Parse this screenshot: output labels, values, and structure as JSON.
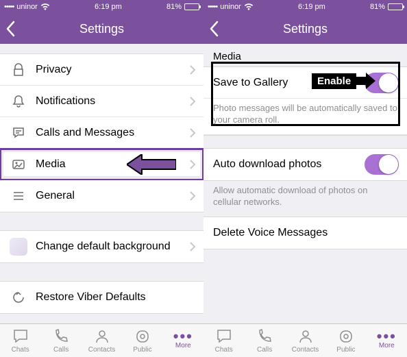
{
  "statusbar": {
    "carrier": "uninor",
    "signal": "•••••",
    "wifi": true,
    "time": "6:19 pm",
    "battery_pct": "81%",
    "battery_fill": 81
  },
  "left": {
    "title": "Settings",
    "items": [
      {
        "icon": "lock",
        "label": "Privacy"
      },
      {
        "icon": "bell",
        "label": "Notifications"
      },
      {
        "icon": "bubble",
        "label": "Calls and Messages"
      },
      {
        "icon": "media",
        "label": "Media",
        "highlighted": true
      },
      {
        "icon": "list",
        "label": "General"
      }
    ],
    "change_bg": "Change default background",
    "restore": "Restore Viber Defaults"
  },
  "right": {
    "title": "Settings",
    "section": "Media",
    "save_label": "Save to Gallery",
    "save_desc": "Photo messages will be automatically saved to your camera roll.",
    "auto_label": "Auto download photos",
    "auto_desc": "Allow automatic download of photos on cellular networks.",
    "delete_label": "Delete Voice Messages"
  },
  "annotation": {
    "enable_label": "Enable"
  },
  "tabs": [
    {
      "label": "Chats",
      "icon": "chats"
    },
    {
      "label": "Calls",
      "icon": "calls"
    },
    {
      "label": "Contacts",
      "icon": "contacts"
    },
    {
      "label": "Public",
      "icon": "public"
    },
    {
      "label": "More",
      "icon": "more",
      "active": true
    }
  ]
}
